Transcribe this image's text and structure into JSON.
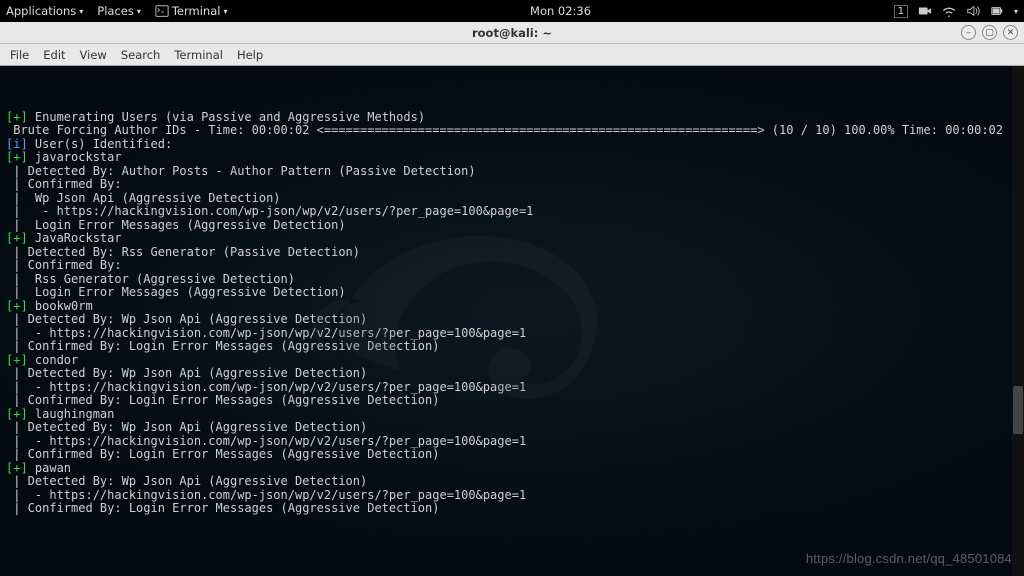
{
  "topbar": {
    "applications": "Applications",
    "places": "Places",
    "terminal": "Terminal",
    "clock": "Mon 02:36",
    "workspace": "1"
  },
  "window": {
    "title": "root@kali: ~"
  },
  "menubar": {
    "file": "File",
    "edit": "Edit",
    "view": "View",
    "search": "Search",
    "terminal": "Terminal",
    "help": "Help"
  },
  "terminal": {
    "lines": [
      {
        "pfx": "[+]",
        "pfxc": "g",
        "txt": " Enumerating Users (via Passive and Aggressive Methods)"
      },
      {
        "pfx": "",
        "pfxc": "",
        "txt": " Brute Forcing Author IDs - Time: 00:00:02 <============================================================> (10 / 10) 100.00% Time: 00:00:02"
      },
      {
        "pfx": "",
        "pfxc": "",
        "txt": ""
      },
      {
        "pfx": "[i]",
        "pfxc": "b",
        "txt": " User(s) Identified:"
      },
      {
        "pfx": "",
        "pfxc": "",
        "txt": ""
      },
      {
        "pfx": "[+]",
        "pfxc": "g",
        "txt": " javarockstar"
      },
      {
        "pfx": "",
        "pfxc": "",
        "txt": " | Detected By: Author Posts - Author Pattern (Passive Detection)"
      },
      {
        "pfx": "",
        "pfxc": "",
        "txt": " | Confirmed By:"
      },
      {
        "pfx": "",
        "pfxc": "",
        "txt": " |  Wp Json Api (Aggressive Detection)"
      },
      {
        "pfx": "",
        "pfxc": "",
        "txt": " |   - https://hackingvision.com/wp-json/wp/v2/users/?per_page=100&page=1"
      },
      {
        "pfx": "",
        "pfxc": "",
        "txt": " |  Login Error Messages (Aggressive Detection)"
      },
      {
        "pfx": "",
        "pfxc": "",
        "txt": ""
      },
      {
        "pfx": "[+]",
        "pfxc": "g",
        "txt": " JavaRockstar"
      },
      {
        "pfx": "",
        "pfxc": "",
        "txt": " | Detected By: Rss Generator (Passive Detection)"
      },
      {
        "pfx": "",
        "pfxc": "",
        "txt": " | Confirmed By:"
      },
      {
        "pfx": "",
        "pfxc": "",
        "txt": " |  Rss Generator (Aggressive Detection)"
      },
      {
        "pfx": "",
        "pfxc": "",
        "txt": " |  Login Error Messages (Aggressive Detection)"
      },
      {
        "pfx": "",
        "pfxc": "",
        "txt": ""
      },
      {
        "pfx": "[+]",
        "pfxc": "g",
        "txt": " bookw0rm"
      },
      {
        "pfx": "",
        "pfxc": "",
        "txt": " | Detected By: Wp Json Api (Aggressive Detection)"
      },
      {
        "pfx": "",
        "pfxc": "",
        "txt": " |  - https://hackingvision.com/wp-json/wp/v2/users/?per_page=100&page=1"
      },
      {
        "pfx": "",
        "pfxc": "",
        "txt": " | Confirmed By: Login Error Messages (Aggressive Detection)"
      },
      {
        "pfx": "",
        "pfxc": "",
        "txt": ""
      },
      {
        "pfx": "[+]",
        "pfxc": "g",
        "txt": " condor"
      },
      {
        "pfx": "",
        "pfxc": "",
        "txt": " | Detected By: Wp Json Api (Aggressive Detection)"
      },
      {
        "pfx": "",
        "pfxc": "",
        "txt": " |  - https://hackingvision.com/wp-json/wp/v2/users/?per_page=100&page=1"
      },
      {
        "pfx": "",
        "pfxc": "",
        "txt": " | Confirmed By: Login Error Messages (Aggressive Detection)"
      },
      {
        "pfx": "",
        "pfxc": "",
        "txt": ""
      },
      {
        "pfx": "[+]",
        "pfxc": "g",
        "txt": " laughingman"
      },
      {
        "pfx": "",
        "pfxc": "",
        "txt": " | Detected By: Wp Json Api (Aggressive Detection)"
      },
      {
        "pfx": "",
        "pfxc": "",
        "txt": " |  - https://hackingvision.com/wp-json/wp/v2/users/?per_page=100&page=1"
      },
      {
        "pfx": "",
        "pfxc": "",
        "txt": " | Confirmed By: Login Error Messages (Aggressive Detection)"
      },
      {
        "pfx": "",
        "pfxc": "",
        "txt": ""
      },
      {
        "pfx": "[+]",
        "pfxc": "g",
        "txt": " pawan"
      },
      {
        "pfx": "",
        "pfxc": "",
        "txt": " | Detected By: Wp Json Api (Aggressive Detection)"
      },
      {
        "pfx": "",
        "pfxc": "",
        "txt": " |  - https://hackingvision.com/wp-json/wp/v2/users/?per_page=100&page=1"
      },
      {
        "pfx": "",
        "pfxc": "",
        "txt": " | Confirmed By: Login Error Messages (Aggressive Detection)"
      }
    ]
  },
  "watermark": "https://blog.csdn.net/qq_48501084"
}
